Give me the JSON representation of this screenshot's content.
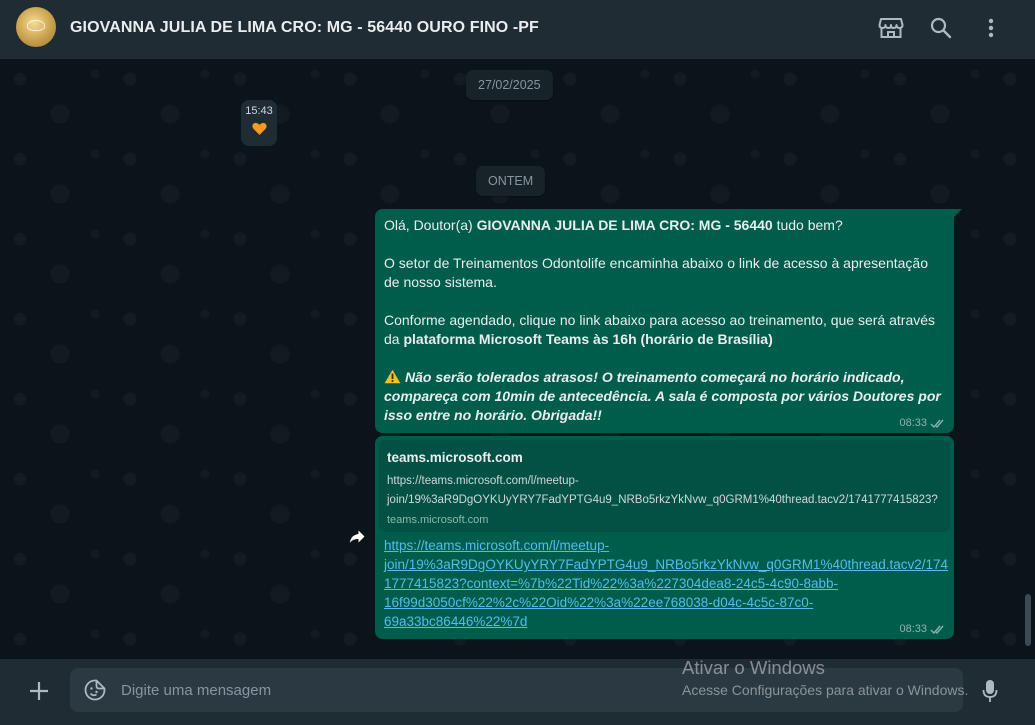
{
  "header": {
    "contact_name": "GIOVANNA JULIA DE LIMA CRO: MG - 56440 OURO FINO -PF",
    "icons": [
      "storefront-icon",
      "search-icon",
      "menu-dots-icon"
    ]
  },
  "chat": {
    "date_chips": [
      "27/02/2025",
      "ONTEM"
    ],
    "small_message": {
      "time": "15:43",
      "content_icon": "orange-heart-emoji"
    },
    "message1": {
      "line1_prefix": "Olá, Doutor(a) ",
      "line1_bold": "GIOVANNA JULIA DE LIMA CRO: MG - 56440",
      "line1_suffix": " tudo bem?",
      "para2_line1": "O setor de Treinamentos Odontolife encaminha abaixo o link de acesso à apresentação",
      "para2_line2": "de nosso sistema.",
      "para3_line1": "Conforme agendado, clique no link abaixo para acesso ao treinamento, que será através",
      "para3_line2_prefix": "da ",
      "para3_line2_bold": "plataforma Microsoft Teams às 16h (horário de Brasília)",
      "warn_icon": "warning-emoji",
      "warn_line1": "Não serão tolerados atrasos! O treinamento começará no horário indicado,",
      "warn_line2": "compareça com 10min de antecedência. A sala é composta por vários Doutores por",
      "warn_line3": "isso entre no horário. Obrigada!!",
      "time": "08:33",
      "status_icon": "double-check-icon"
    },
    "message2": {
      "preview_title": "teams.microsoft.com",
      "preview_desc_line1": "https://teams.microsoft.com/l/meetup-",
      "preview_desc_line2": "join/19%3aR9DgOYKUyYRY7FadYPTG4u9_NRBo5rkzYkNvw_q0GRM1%40thread.tacv2/1741777415823?",
      "preview_domain": "teams.microsoft.com",
      "link_line1": "https://teams.microsoft.com/l/meetup-",
      "link_line2": "join/19%3aR9DgOYKUyYRY7FadYPTG4u9_NRBo5rkzYkNvw_q0GRM1%40thread.tacv2/174",
      "link_line3": "1777415823?context=%7b%22Tid%22%3a%227304dea8-24c5-4c90-8abb-",
      "link_line4": "16f99d3050cf%22%2c%22Oid%22%3a%22ee768038-d04c-4c5c-87c0-",
      "link_line5": "69a33bc86446%22%7d",
      "time": "08:33",
      "status_icon": "double-check-icon"
    }
  },
  "footer": {
    "placeholder": "Digite uma mensagem",
    "icons": [
      "plus-icon",
      "sticker-icon",
      "mic-icon"
    ]
  },
  "watermark": {
    "title": "Ativar o Windows",
    "subtitle": "Acesse Configurações para ativar o Windows."
  },
  "colors": {
    "header_bg": "#202c33",
    "chat_bg": "#0b141a",
    "outgoing_bubble": "#005c4b",
    "link": "#53bdeb"
  }
}
